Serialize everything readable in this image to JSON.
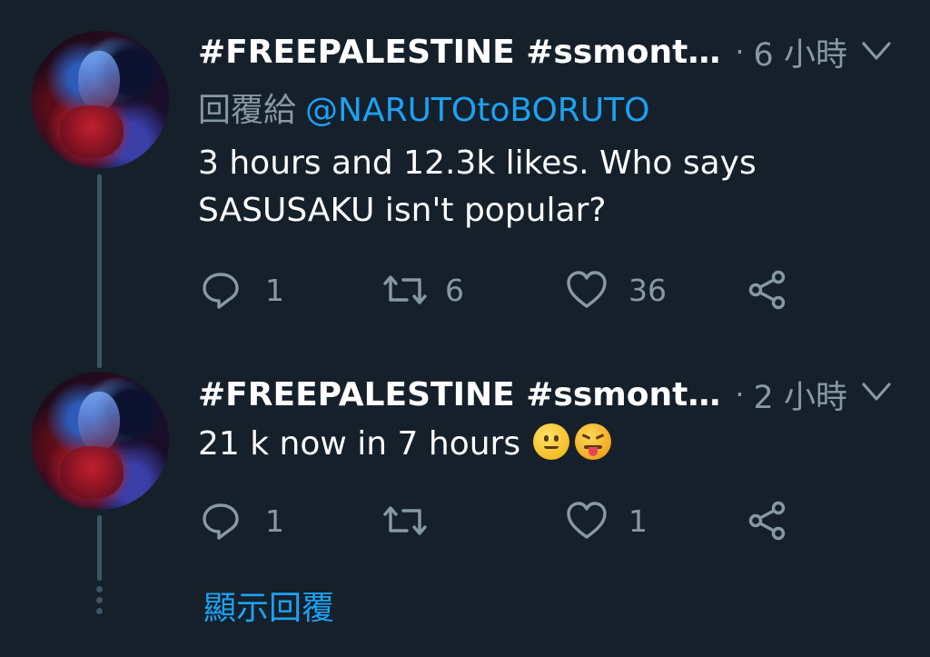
{
  "tweets": [
    {
      "display_name": "#FREEPALESTINE #ssmont…",
      "separator": "·",
      "time": "6 小時",
      "reply_label": "回覆給",
      "reply_handle": "@NARUTOtoBORUTO",
      "text_lines": [
        "3 hours and 12.3k likes. Who says",
        "SASUSAKU isn't popular?"
      ],
      "replies": "1",
      "retweets": "6",
      "likes": "36"
    },
    {
      "display_name": "#FREEPALESTINE #ssmont…",
      "separator": "·",
      "time": "2 小時",
      "text": "21 k now in 7 hours",
      "emojis": [
        "slightly-smiling-face",
        "squinting-face-with-tongue"
      ],
      "replies": "1",
      "retweets": "",
      "likes": "1"
    }
  ],
  "show_replies_label": "顯示回覆",
  "colors": {
    "background": "#15202b",
    "text": "#ffffff",
    "secondary": "#8899a6",
    "accent": "#1da1f2",
    "thread_line": "#3d5466"
  }
}
